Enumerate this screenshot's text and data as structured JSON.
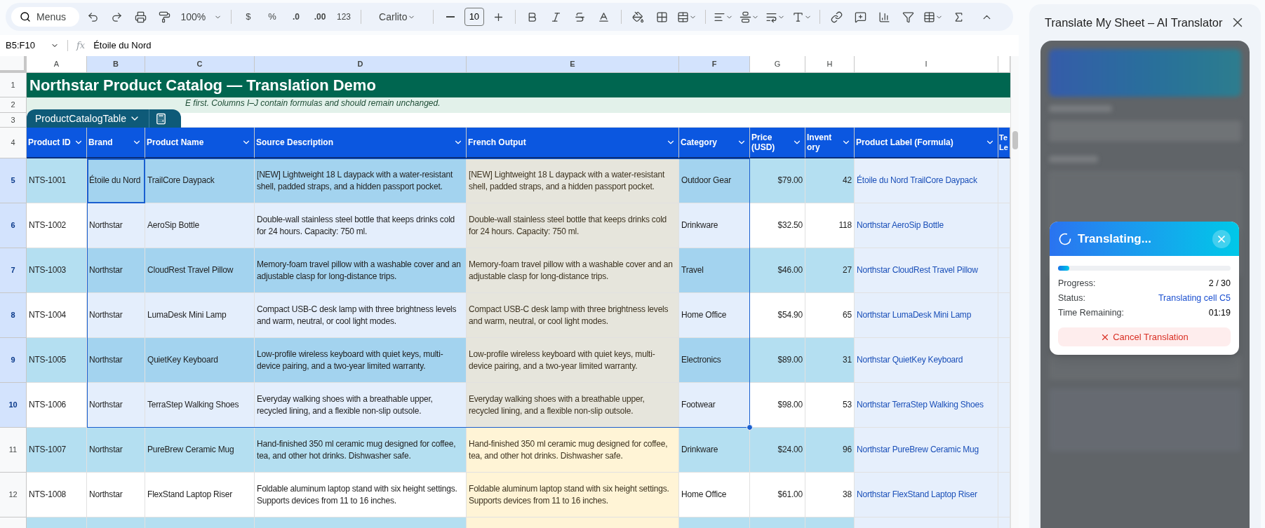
{
  "toolbar": {
    "search_label": "Menus",
    "zoom": "100%",
    "currency": "$",
    "percent": "%",
    "decrease_decimals": ".0",
    "increase_decimals": ".00",
    "number_format": "123",
    "font": "Carlito",
    "font_size": "10"
  },
  "formula_bar": {
    "cell_range": "B5:F10",
    "fx": "fx",
    "value": "Étoile du Nord"
  },
  "columns": [
    {
      "letter": "A",
      "header": "Product ID",
      "kind": "text",
      "selected": false
    },
    {
      "letter": "B",
      "header": "Brand",
      "kind": "text",
      "selected": true
    },
    {
      "letter": "C",
      "header": "Product Name",
      "kind": "text",
      "selected": true
    },
    {
      "letter": "D",
      "header": "Source Description",
      "kind": "text",
      "selected": true
    },
    {
      "letter": "E",
      "header": "French Output",
      "kind": "output",
      "selected": true
    },
    {
      "letter": "F",
      "header": "Category",
      "kind": "text",
      "selected": true
    },
    {
      "letter": "G",
      "header": "Price (USD)",
      "kind": "number",
      "selected": false
    },
    {
      "letter": "H",
      "header": "Invent ory",
      "kind": "number",
      "selected": false
    },
    {
      "letter": "I",
      "header": "Product Label (Formula)",
      "kind": "formula",
      "selected": false
    },
    {
      "header": "Te Le",
      "kind": "formula",
      "selected": false
    }
  ],
  "top_row_numbers": [
    "1",
    "2",
    "3",
    "4"
  ],
  "title": "Northstar Product Catalog — Translation Demo",
  "note": "E first. Columns I–J contain formulas and should remain unchanged.",
  "table_chip": {
    "name": "ProductCatalogTable"
  },
  "rows": [
    {
      "number": "5",
      "selected": true,
      "active": true,
      "cells": [
        "NTS-1001",
        "Étoile du Nord",
        "TrailCore Daypack",
        "[NEW] Lightweight 18 L daypack with a water-resistant shell, padded straps, and a hidden passport pocket.",
        "[NEW] Lightweight 18 L daypack with a water-resistant shell, padded straps, and a hidden passport pocket.",
        "Outdoor Gear",
        "$79.00",
        "42",
        "Étoile du Nord TrailCore Daypack"
      ]
    },
    {
      "number": "6",
      "selected": true,
      "active": false,
      "cells": [
        "NTS-1002",
        "Northstar",
        "AeroSip Bottle",
        "Double-wall stainless steel bottle that keeps drinks cold for 24 hours. Capacity: 750 ml.",
        "Double-wall stainless steel bottle that keeps drinks cold for 24 hours. Capacity: 750 ml.",
        "Drinkware",
        "$32.50",
        "118",
        "Northstar AeroSip Bottle"
      ]
    },
    {
      "number": "7",
      "selected": true,
      "active": false,
      "cells": [
        "NTS-1003",
        "Northstar",
        "CloudRest Travel Pillow",
        "Memory-foam travel pillow with a washable cover and an adjustable clasp for long-distance trips.",
        "Memory-foam travel pillow with a washable cover and an adjustable clasp for long-distance trips.",
        "Travel",
        "$46.00",
        "27",
        "Northstar CloudRest Travel Pillow"
      ]
    },
    {
      "number": "8",
      "selected": true,
      "active": false,
      "cells": [
        "NTS-1004",
        "Northstar",
        "LumaDesk Mini Lamp",
        "Compact USB-C desk lamp with three brightness levels and warm, neutral, or cool light modes.",
        "Compact USB-C desk lamp with three brightness levels and warm, neutral, or cool light modes.",
        "Home Office",
        "$54.90",
        "65",
        "Northstar LumaDesk Mini Lamp"
      ]
    },
    {
      "number": "9",
      "selected": true,
      "active": false,
      "cells": [
        "NTS-1005",
        "Northstar",
        "QuietKey Keyboard",
        "Low-profile wireless keyboard with quiet keys, multi-device pairing, and a two-year limited warranty.",
        "Low-profile wireless keyboard with quiet keys, multi-device pairing, and a two-year limited warranty.",
        "Electronics",
        "$89.00",
        "31",
        "Northstar QuietKey Keyboard"
      ]
    },
    {
      "number": "10",
      "selected": true,
      "active": false,
      "cells": [
        "NTS-1006",
        "Northstar",
        "TerraStep Walking Shoes",
        "Everyday walking shoes with a breathable upper, recycled lining, and a flexible non-slip outsole.",
        "Everyday walking shoes with a breathable upper, recycled lining, and a flexible non-slip outsole.",
        "Footwear",
        "$98.00",
        "53",
        "Northstar TerraStep Walking Shoes"
      ]
    },
    {
      "number": "11",
      "selected": false,
      "active": false,
      "cells": [
        "NTS-1007",
        "Northstar",
        "PureBrew Ceramic Mug",
        "Hand-finished 350 ml ceramic mug designed for coffee, tea, and other hot drinks. Dishwasher safe.",
        "Hand-finished 350 ml ceramic mug designed for coffee, tea, and other hot drinks. Dishwasher safe.",
        "Drinkware",
        "$24.00",
        "96",
        "Northstar PureBrew Ceramic Mug"
      ]
    },
    {
      "number": "12",
      "selected": false,
      "active": false,
      "cells": [
        "NTS-1008",
        "Northstar",
        "FlexStand Laptop Riser",
        "Foldable aluminum laptop stand with six height settings. Supports devices from 11 to 16 inches.",
        "Foldable aluminum laptop stand with six height settings. Supports devices from 11 to 16 inches.",
        "Home Office",
        "$61.00",
        "38",
        "Northstar FlexStand Laptop Riser"
      ]
    }
  ],
  "side_panel": {
    "title": "Translate My Sheet – AI Translator",
    "dialog": {
      "title": "Translating...",
      "level": 0.067,
      "fields": [
        {
          "label": "Progress:",
          "value": "2 / 30",
          "kind": "plain"
        },
        {
          "label": "Status:",
          "value": "Translating cell C5",
          "kind": "link"
        },
        {
          "label": "Time Remaining:",
          "value": "01:19",
          "kind": "plain"
        }
      ],
      "cancel": "Cancel Translation"
    }
  }
}
